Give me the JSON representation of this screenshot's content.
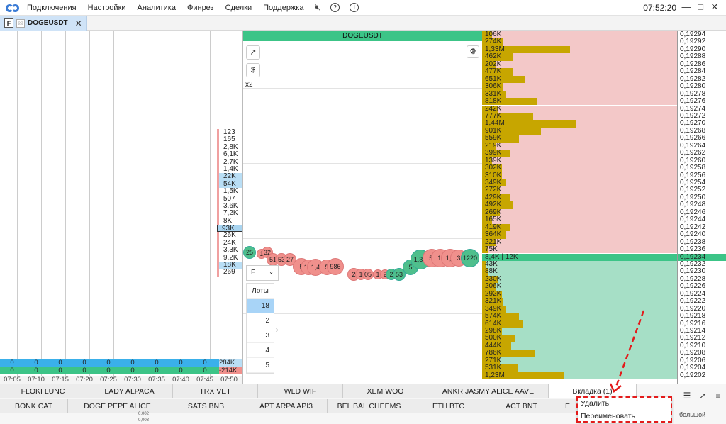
{
  "menubar": {
    "items": [
      "Подключения",
      "Настройки",
      "Аналитика",
      "Финрез",
      "Сделки",
      "Поддержка"
    ],
    "icons": [
      "no-sound-icon",
      "help-icon",
      "info-icon"
    ],
    "clock": "07:52:20"
  },
  "tab": {
    "title": "DOGEUSDT",
    "f_label": "F"
  },
  "left": {
    "volumes": [
      "123",
      "165",
      "2,8K",
      "6,1K",
      "2,7K",
      "1,4K",
      "22K",
      "54K",
      "1,5K",
      "507",
      "3,6K",
      "7,2K",
      "8K",
      "93K",
      "26K",
      "24K",
      "3,3K",
      "9,2K",
      "18K",
      "269"
    ],
    "blue_strip": [
      "0",
      "0",
      "0",
      "0",
      "0",
      "0",
      "0",
      "0",
      "0",
      "284K"
    ],
    "green_strip": [
      "0",
      "0",
      "0",
      "0",
      "0",
      "0",
      "0",
      "0",
      "0",
      "-214K"
    ],
    "times": [
      "07:05",
      "07:10",
      "07:15",
      "07:20",
      "07:25",
      "07:30",
      "07:35",
      "07:40",
      "07:45",
      "07:50"
    ]
  },
  "chart": {
    "title": "DOGEUSDT",
    "zoom": "x2",
    "select_value": "F",
    "lots_header": "Лоты",
    "lots": [
      "18",
      "2",
      "3",
      "4",
      "5"
    ],
    "bubbles": [
      {
        "t": "25",
        "c": "g"
      },
      {
        "t": "1",
        "c": "r"
      },
      {
        "t": "32",
        "c": "r"
      },
      {
        "t": "51",
        "c": "r"
      },
      {
        "t": "53",
        "c": "r"
      },
      {
        "t": "27",
        "c": "r"
      },
      {
        "t": "5",
        "c": "r"
      },
      {
        "t": "1,1",
        "c": "r"
      },
      {
        "t": "1,4",
        "c": "r"
      },
      {
        "t": "5",
        "c": "r"
      },
      {
        "t": "986",
        "c": "r"
      },
      {
        "t": "2",
        "c": "r"
      },
      {
        "t": "1",
        "c": "r"
      },
      {
        "t": "05",
        "c": "r"
      },
      {
        "t": "1",
        "c": "r"
      },
      {
        "t": "2",
        "c": "r"
      },
      {
        "t": "2",
        "c": "g"
      },
      {
        "t": "53",
        "c": "g"
      },
      {
        "t": "5",
        "c": "g"
      },
      {
        "t": "1,3K",
        "c": "g"
      },
      {
        "t": "5,",
        "c": "r"
      },
      {
        "t": "1,",
        "c": "r"
      },
      {
        "t": "1,9",
        "c": "r"
      },
      {
        "t": "3",
        "c": "r"
      },
      {
        "t": "1220",
        "c": "g"
      }
    ]
  },
  "dom": {
    "rows": [
      {
        "v": "106K",
        "f": 0.05,
        "s": "ask"
      },
      {
        "v": "274K",
        "f": 0.11,
        "s": "ask"
      },
      {
        "v": "1,33M",
        "f": 0.45,
        "s": "ask"
      },
      {
        "v": "462K",
        "f": 0.16,
        "s": "ask"
      },
      {
        "v": "202K",
        "f": 0.07,
        "s": "ask"
      },
      {
        "v": "477K",
        "f": 0.16,
        "s": "ask"
      },
      {
        "v": "651K",
        "f": 0.22,
        "s": "ask"
      },
      {
        "v": "306K",
        "f": 0.11,
        "s": "ask"
      },
      {
        "v": "331K",
        "f": 0.12,
        "s": "ask"
      },
      {
        "v": "818K",
        "f": 0.28,
        "s": "ask"
      },
      {
        "v": "242K",
        "f": 0.08,
        "s": "ask"
      },
      {
        "v": "777K",
        "f": 0.26,
        "s": "ask"
      },
      {
        "v": "1,44M",
        "f": 0.48,
        "s": "ask"
      },
      {
        "v": "901K",
        "f": 0.3,
        "s": "ask"
      },
      {
        "v": "559K",
        "f": 0.19,
        "s": "ask"
      },
      {
        "v": "219K",
        "f": 0.07,
        "s": "ask"
      },
      {
        "v": "399K",
        "f": 0.14,
        "s": "ask"
      },
      {
        "v": "139K",
        "f": 0.05,
        "s": "ask"
      },
      {
        "v": "302K",
        "f": 0.1,
        "s": "ask"
      },
      {
        "v": "310K",
        "f": 0.1,
        "s": "ask"
      },
      {
        "v": "349K",
        "f": 0.12,
        "s": "ask"
      },
      {
        "v": "272K",
        "f": 0.09,
        "s": "ask"
      },
      {
        "v": "429K",
        "f": 0.14,
        "s": "ask"
      },
      {
        "v": "492K",
        "f": 0.16,
        "s": "ask"
      },
      {
        "v": "269K",
        "f": 0.09,
        "s": "ask"
      },
      {
        "v": "165K",
        "f": 0.05,
        "s": "ask"
      },
      {
        "v": "419K",
        "f": 0.14,
        "s": "ask"
      },
      {
        "v": "364K",
        "f": 0.12,
        "s": "ask"
      },
      {
        "v": "221K",
        "f": 0.07,
        "s": "ask"
      },
      {
        "v": "75K",
        "f": 0.03,
        "s": "ask"
      },
      {
        "v": "8,4K | 12K",
        "f": 0,
        "s": "mid"
      },
      {
        "v": "43K",
        "f": 0.02,
        "s": "bid"
      },
      {
        "v": "88K",
        "f": 0.03,
        "s": "bid"
      },
      {
        "v": "230K",
        "f": 0.08,
        "s": "bid"
      },
      {
        "v": "206K",
        "f": 0.07,
        "s": "bid"
      },
      {
        "v": "292K",
        "f": 0.1,
        "s": "bid"
      },
      {
        "v": "321K",
        "f": 0.11,
        "s": "bid"
      },
      {
        "v": "349K",
        "f": 0.12,
        "s": "bid"
      },
      {
        "v": "574K",
        "f": 0.19,
        "s": "bid"
      },
      {
        "v": "614K",
        "f": 0.21,
        "s": "bid"
      },
      {
        "v": "298K",
        "f": 0.1,
        "s": "bid"
      },
      {
        "v": "500K",
        "f": 0.17,
        "s": "bid"
      },
      {
        "v": "444K",
        "f": 0.15,
        "s": "bid"
      },
      {
        "v": "786K",
        "f": 0.27,
        "s": "bid"
      },
      {
        "v": "271K",
        "f": 0.09,
        "s": "bid"
      },
      {
        "v": "531K",
        "f": 0.18,
        "s": "bid"
      },
      {
        "v": "1,23M",
        "f": 0.42,
        "s": "bid"
      }
    ],
    "prices": [
      "0,19294",
      "0,19292",
      "0,19290",
      "0,19288",
      "0,19286",
      "0,19284",
      "0,19282",
      "0,19280",
      "0,19278",
      "0,19276",
      "0,19274",
      "0,19272",
      "0,19270",
      "0,19268",
      "0,19266",
      "0,19264",
      "0,19262",
      "0,19260",
      "0,19258",
      "0,19256",
      "0,19254",
      "0,19252",
      "0,19250",
      "0,19248",
      "0,19246",
      "0,19244",
      "0,19242",
      "0,19240",
      "0,19238",
      "0,19236",
      "0,19234",
      "0,19232",
      "0,19230",
      "0,19228",
      "0,19226",
      "0,19224",
      "0,19222",
      "0,19220",
      "0,19218",
      "0,19216",
      "0,19214",
      "0,19212",
      "0,19210",
      "0,19208",
      "0,19206",
      "0,19204",
      "0,19202"
    ],
    "colors": {
      "ask_bg": "#f3c8c8",
      "bid_bg": "#a6dfc6",
      "mid_bg": "#3cc487",
      "bar": "#c7a600"
    }
  },
  "workspace": {
    "row1": [
      "FLOKI LUNC",
      "LADY ALPACA",
      "TRX VET",
      "WLD WIF",
      "XEM WOO",
      "ANKR JASMY ALICE AAVE",
      "Вкладка (1)"
    ],
    "row2": [
      "BONK CAT",
      "DOGE PEPE ALICE",
      "SATS BNB",
      "APT ARPA API3",
      "BEL BAL CHEEMS",
      "ETH BTC",
      "ACT BNT",
      "E"
    ],
    "big_word": "большой",
    "sub_text": [
      "0,002",
      "0,003"
    ]
  },
  "context_menu": {
    "items": [
      "Удалить",
      "Переименовать"
    ]
  }
}
